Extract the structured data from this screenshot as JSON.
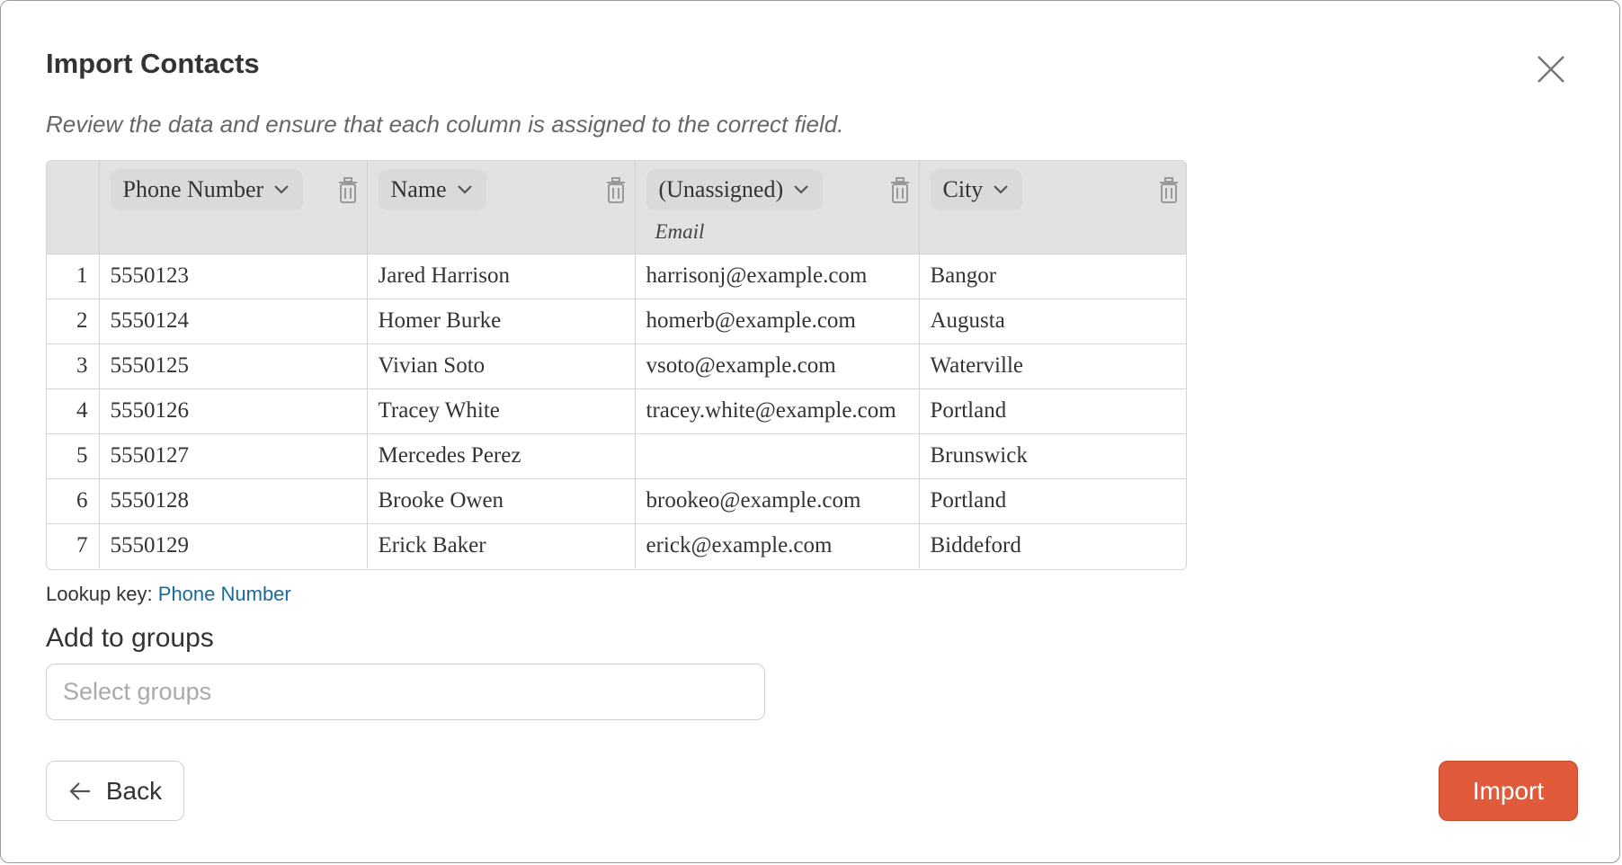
{
  "dialog": {
    "title": "Import Contacts",
    "subtitle": "Review the data and ensure that each column is assigned to the correct field."
  },
  "table": {
    "columns": [
      {
        "field": "Phone Number",
        "note": ""
      },
      {
        "field": "Name",
        "note": ""
      },
      {
        "field": "(Unassigned)",
        "note": "Email"
      },
      {
        "field": "City",
        "note": ""
      }
    ],
    "rows": [
      {
        "num": "1",
        "cells": [
          "5550123",
          "Jared Harrison",
          "harrisonj@example.com",
          "Bangor"
        ]
      },
      {
        "num": "2",
        "cells": [
          "5550124",
          "Homer Burke",
          "homerb@example.com",
          "Augusta"
        ]
      },
      {
        "num": "3",
        "cells": [
          "5550125",
          "Vivian Soto",
          "vsoto@example.com",
          "Waterville"
        ]
      },
      {
        "num": "4",
        "cells": [
          "5550126",
          "Tracey White",
          "tracey.white@example.com",
          "Portland"
        ]
      },
      {
        "num": "5",
        "cells": [
          "5550127",
          "Mercedes Perez",
          "",
          "Brunswick"
        ]
      },
      {
        "num": "6",
        "cells": [
          "5550128",
          "Brooke Owen",
          "brookeo@example.com",
          "Portland"
        ]
      },
      {
        "num": "7",
        "cells": [
          "5550129",
          "Erick Baker",
          "erick@example.com",
          "Biddeford"
        ]
      }
    ]
  },
  "lookup": {
    "label": "Lookup key:",
    "value": "Phone Number"
  },
  "groups": {
    "label": "Add to groups",
    "placeholder": "Select groups",
    "value": ""
  },
  "buttons": {
    "back": "Back",
    "import": "Import"
  },
  "colors": {
    "accent": "#e15b3b",
    "link": "#1a6a9a",
    "header_bg": "#e2e2e2"
  },
  "icons": [
    "close-icon",
    "chevron-down-icon",
    "trash-icon",
    "arrow-left-icon"
  ]
}
